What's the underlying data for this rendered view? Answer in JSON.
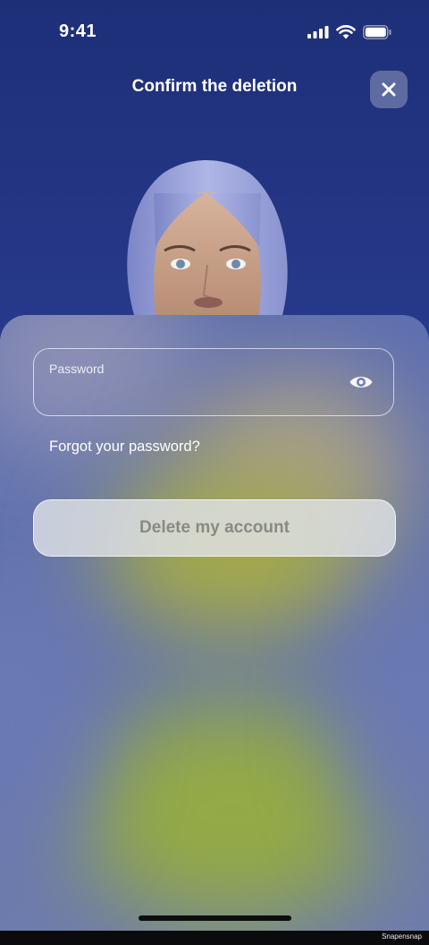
{
  "status_bar": {
    "time": "9:41"
  },
  "header": {
    "title": "Confirm the deletion"
  },
  "password_field": {
    "label": "Password",
    "value": ""
  },
  "forgot_link": "Forgot your password?",
  "delete_button": "Delete my account",
  "watermark": "Snapensnap",
  "icons": {
    "close": "close-icon",
    "eye": "eye-icon",
    "signal": "signal-icon",
    "wifi": "wifi-icon",
    "battery": "battery-icon"
  },
  "colors": {
    "background": "#27398a",
    "sheet": "#6a78b0",
    "button_text": "#8a8a84"
  }
}
